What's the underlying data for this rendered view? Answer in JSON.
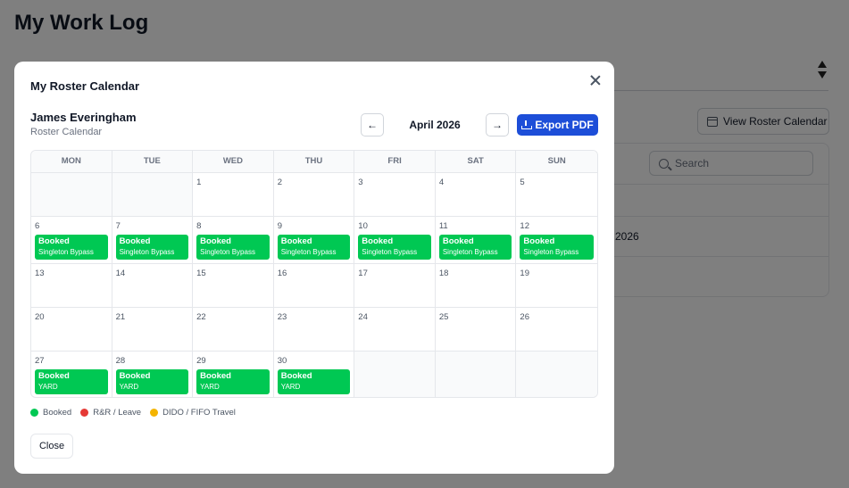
{
  "background": {
    "title": "My Work Log",
    "view_roster_label": "View Roster Calendar",
    "search_placeholder": "Search",
    "row_text": "2026"
  },
  "modal": {
    "title": "My Roster Calendar",
    "person_name": "James Everingham",
    "person_sub": "Roster Calendar",
    "month": "April 2026",
    "prev_label": "←",
    "next_label": "→",
    "export_label": "Export PDF",
    "close_label": "Close"
  },
  "calendar": {
    "weekdays": [
      "MON",
      "TUE",
      "WED",
      "THU",
      "FRI",
      "SAT",
      "SUN"
    ],
    "cells": [
      {
        "day": ""
      },
      {
        "day": ""
      },
      {
        "day": "1"
      },
      {
        "day": "2"
      },
      {
        "day": "3"
      },
      {
        "day": "4"
      },
      {
        "day": "5"
      },
      {
        "day": "6",
        "event": {
          "title": "Booked",
          "location": "Singleton Bypass"
        }
      },
      {
        "day": "7",
        "event": {
          "title": "Booked",
          "location": "Singleton Bypass"
        }
      },
      {
        "day": "8",
        "event": {
          "title": "Booked",
          "location": "Singleton Bypass"
        }
      },
      {
        "day": "9",
        "event": {
          "title": "Booked",
          "location": "Singleton Bypass"
        }
      },
      {
        "day": "10",
        "event": {
          "title": "Booked",
          "location": "Singleton Bypass"
        }
      },
      {
        "day": "11",
        "event": {
          "title": "Booked",
          "location": "Singleton Bypass"
        }
      },
      {
        "day": "12",
        "event": {
          "title": "Booked",
          "location": "Singleton Bypass"
        }
      },
      {
        "day": "13"
      },
      {
        "day": "14"
      },
      {
        "day": "15"
      },
      {
        "day": "16"
      },
      {
        "day": "17"
      },
      {
        "day": "18"
      },
      {
        "day": "19"
      },
      {
        "day": "20"
      },
      {
        "day": "21"
      },
      {
        "day": "22"
      },
      {
        "day": "23"
      },
      {
        "day": "24"
      },
      {
        "day": "25"
      },
      {
        "day": "26"
      },
      {
        "day": "27",
        "event": {
          "title": "Booked",
          "location": "YARD"
        }
      },
      {
        "day": "28",
        "event": {
          "title": "Booked",
          "location": "YARD"
        }
      },
      {
        "day": "29",
        "event": {
          "title": "Booked",
          "location": "YARD"
        }
      },
      {
        "day": "30",
        "event": {
          "title": "Booked",
          "location": "YARD"
        }
      },
      {
        "day": ""
      },
      {
        "day": ""
      },
      {
        "day": ""
      }
    ]
  },
  "legend": [
    {
      "label": "Booked",
      "color": "#00c853"
    },
    {
      "label": "R&R / Leave",
      "color": "#e53935"
    },
    {
      "label": "DIDO / FIFO Travel",
      "color": "#f4b400"
    }
  ],
  "colors": {
    "booked": "#00c853",
    "primary": "#1d4ed8"
  }
}
